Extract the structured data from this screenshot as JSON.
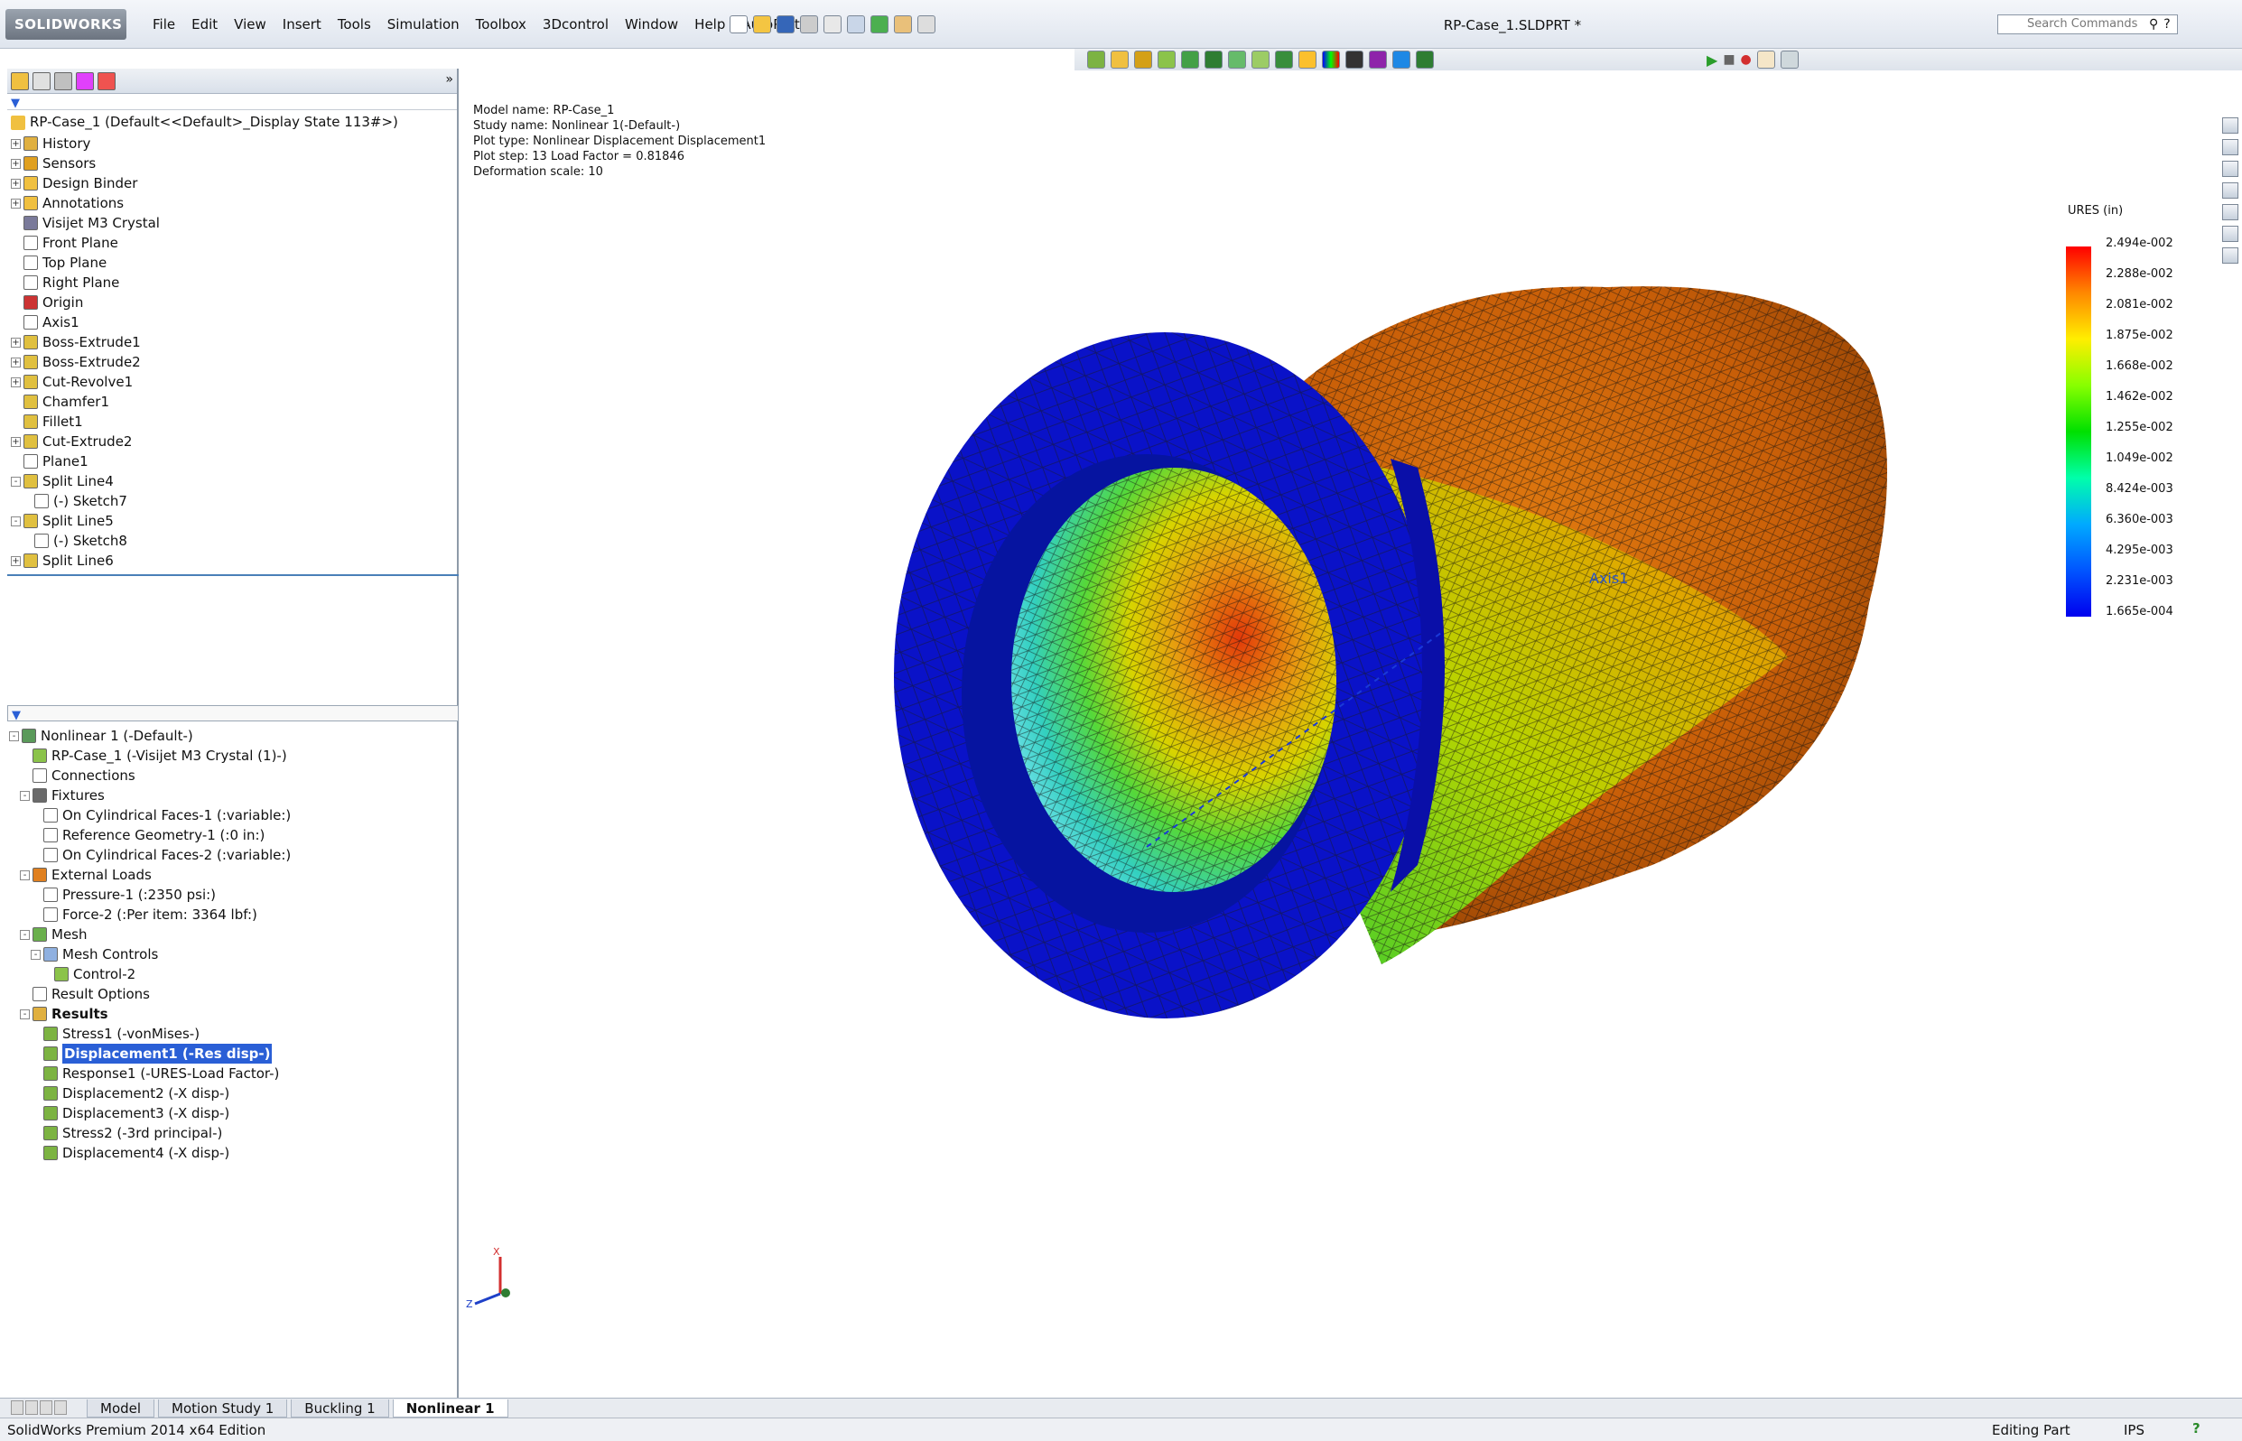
{
  "app": {
    "logo": "SOLIDWORKS",
    "document_title": "RP-Case_1.SLDPRT *",
    "search_placeholder": "Search Commands"
  },
  "menu": [
    "File",
    "Edit",
    "View",
    "Insert",
    "Tools",
    "Simulation",
    "Toolbox",
    "3Dcontrol",
    "Window",
    "Help",
    "AutoPart"
  ],
  "feature_tree": {
    "root": "RP-Case_1  (Default<<Default>_Display State 113#>)",
    "items": [
      {
        "label": "History",
        "expand": "+",
        "icon": "history-icon",
        "indent": 0
      },
      {
        "label": "Sensors",
        "expand": "+",
        "icon": "sensor-icon",
        "indent": 0
      },
      {
        "label": "Design Binder",
        "expand": "+",
        "icon": "binder-icon",
        "indent": 0
      },
      {
        "label": "Annotations",
        "expand": "+",
        "icon": "annotation-icon",
        "indent": 0
      },
      {
        "label": "Visijet M3 Crystal",
        "expand": "",
        "icon": "material-icon",
        "indent": 0
      },
      {
        "label": "Front Plane",
        "expand": "",
        "icon": "plane-icon",
        "indent": 0
      },
      {
        "label": "Top Plane",
        "expand": "",
        "icon": "plane-icon",
        "indent": 0
      },
      {
        "label": "Right Plane",
        "expand": "",
        "icon": "plane-icon",
        "indent": 0
      },
      {
        "label": "Origin",
        "expand": "",
        "icon": "origin-icon",
        "indent": 0
      },
      {
        "label": "Axis1",
        "expand": "",
        "icon": "axis-icon",
        "indent": 0
      },
      {
        "label": "Boss-Extrude1",
        "expand": "+",
        "icon": "feature-icon",
        "indent": 0
      },
      {
        "label": "Boss-Extrude2",
        "expand": "+",
        "icon": "feature-icon",
        "indent": 0
      },
      {
        "label": "Cut-Revolve1",
        "expand": "+",
        "icon": "feature-icon",
        "indent": 0
      },
      {
        "label": "Chamfer1",
        "expand": "",
        "icon": "chamfer-icon",
        "indent": 0
      },
      {
        "label": "Fillet1",
        "expand": "",
        "icon": "fillet-icon",
        "indent": 0
      },
      {
        "label": "Cut-Extrude2",
        "expand": "+",
        "icon": "feature-icon",
        "indent": 0
      },
      {
        "label": "Plane1",
        "expand": "",
        "icon": "plane-icon",
        "indent": 0
      },
      {
        "label": "Split Line4",
        "expand": "-",
        "icon": "splitline-icon",
        "indent": 0
      },
      {
        "label": "(-) Sketch7",
        "expand": "",
        "icon": "sketch-icon",
        "indent": 1
      },
      {
        "label": "Split Line5",
        "expand": "-",
        "icon": "splitline-icon",
        "indent": 0
      },
      {
        "label": "(-) Sketch8",
        "expand": "",
        "icon": "sketch-icon",
        "indent": 1
      },
      {
        "label": "Split Line6",
        "expand": "+",
        "icon": "splitline-icon",
        "indent": 0
      }
    ]
  },
  "study_tree": {
    "items": [
      {
        "label": "Nonlinear 1 (-Default-)",
        "expand": "-",
        "indent": 0,
        "icon": "study-icon"
      },
      {
        "label": "RP-Case_1 (-Visijet M3 Crystal (1)-)",
        "expand": "",
        "indent": 1,
        "icon": "part-icon"
      },
      {
        "label": "Connections",
        "expand": "",
        "indent": 1,
        "icon": "connection-icon"
      },
      {
        "label": "Fixtures",
        "expand": "-",
        "indent": 1,
        "icon": "fixture-icon"
      },
      {
        "label": "On Cylindrical Faces-1 (:variable:)",
        "expand": "",
        "indent": 2,
        "icon": "cyl-fixture-icon"
      },
      {
        "label": "Reference Geometry-1 (:0 in:)",
        "expand": "",
        "indent": 2,
        "icon": "refgeom-icon"
      },
      {
        "label": "On Cylindrical Faces-2 (:variable:)",
        "expand": "",
        "indent": 2,
        "icon": "cyl-fixture-icon"
      },
      {
        "label": "External Loads",
        "expand": "-",
        "indent": 1,
        "icon": "load-icon"
      },
      {
        "label": "Pressure-1 (:2350 psi:)",
        "expand": "",
        "indent": 2,
        "icon": "pressure-icon"
      },
      {
        "label": "Force-2 (:Per item: 3364 lbf:)",
        "expand": "",
        "indent": 2,
        "icon": "force-icon"
      },
      {
        "label": "Mesh",
        "expand": "-",
        "indent": 1,
        "icon": "mesh-icon"
      },
      {
        "label": "Mesh Controls",
        "expand": "-",
        "indent": 2,
        "icon": "meshcontrol-icon"
      },
      {
        "label": "Control-2",
        "expand": "",
        "indent": 3,
        "icon": "control-icon"
      },
      {
        "label": "Result Options",
        "expand": "",
        "indent": 1,
        "icon": "resultoptions-icon"
      },
      {
        "label": "Results",
        "expand": "-",
        "indent": 1,
        "icon": "results-icon",
        "bold": true
      },
      {
        "label": "Stress1 (-vonMises-)",
        "expand": "",
        "indent": 2,
        "icon": "plot-icon"
      },
      {
        "label": "Displacement1 (-Res disp-)",
        "expand": "",
        "indent": 2,
        "icon": "plot-icon",
        "selected": true
      },
      {
        "label": "Response1 (-URES-Load Factor-)",
        "expand": "",
        "indent": 2,
        "icon": "plot-icon"
      },
      {
        "label": "Displacement2 (-X disp-)",
        "expand": "",
        "indent": 2,
        "icon": "plot-icon"
      },
      {
        "label": "Displacement3 (-X disp-)",
        "expand": "",
        "indent": 2,
        "icon": "plot-icon"
      },
      {
        "label": "Stress2 (-3rd principal-)",
        "expand": "",
        "indent": 2,
        "icon": "plot-icon"
      },
      {
        "label": "Displacement4 (-X disp-)",
        "expand": "",
        "indent": 2,
        "icon": "plot-icon"
      }
    ]
  },
  "plot_info": {
    "model_name": "Model name: RP-Case_1",
    "study_name": "Study name: Nonlinear 1(-Default-)",
    "plot_type": "Plot type: Nonlinear Displacement Displacement1",
    "plot_step": "Plot step: 13   Load Factor = 0.81846",
    "deformation": "Deformation scale: 10"
  },
  "legend": {
    "title": "URES (in)",
    "values": [
      "2.494e-002",
      "2.288e-002",
      "2.081e-002",
      "1.875e-002",
      "1.668e-002",
      "1.462e-002",
      "1.255e-002",
      "1.049e-002",
      "8.424e-003",
      "6.360e-003",
      "4.295e-003",
      "2.231e-003",
      "1.665e-004"
    ]
  },
  "axis_label": "Axis1",
  "triad": {
    "x": "X",
    "z": "Z"
  },
  "bottom_tabs": [
    "Model",
    "Motion Study 1",
    "Buckling 1",
    "Nonlinear 1"
  ],
  "active_tab": "Nonlinear 1",
  "status": {
    "edition": "SolidWorks Premium 2014 x64 Edition",
    "mode": "Editing Part",
    "units": "IPS"
  }
}
